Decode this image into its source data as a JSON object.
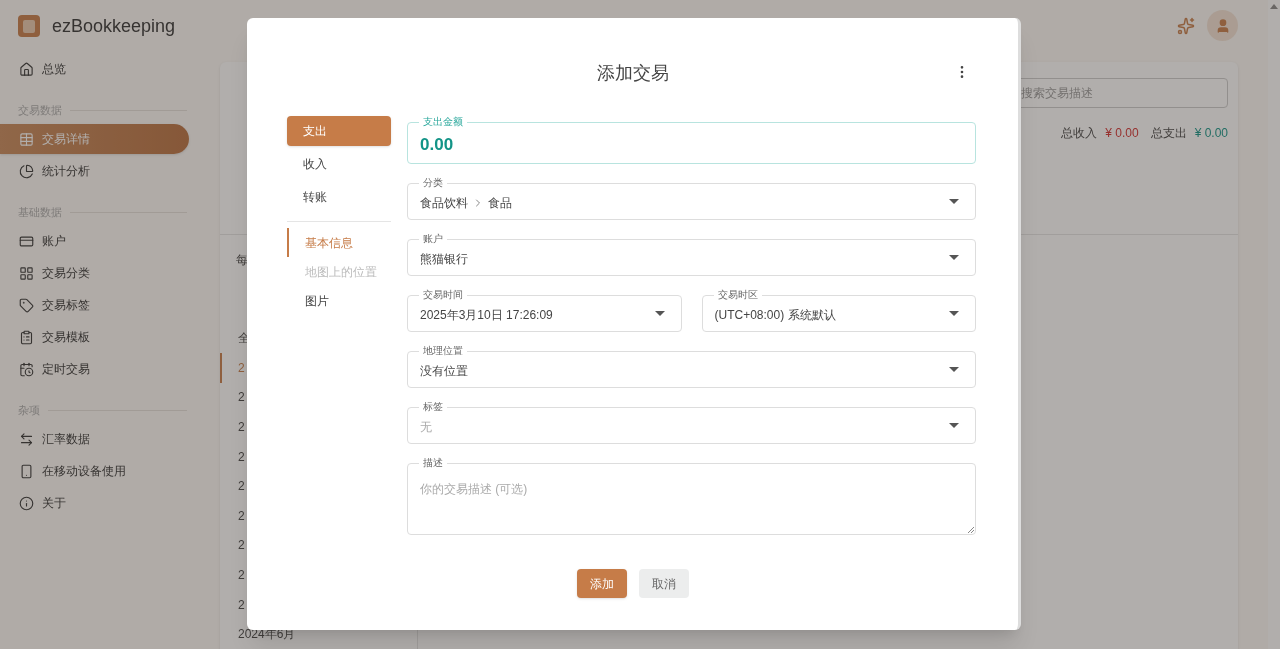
{
  "app": {
    "name": "ezBookkeeping"
  },
  "sidebar": {
    "sections": [
      {
        "items": [
          {
            "label": "总览",
            "selected": false
          }
        ]
      },
      {
        "title": "交易数据",
        "items": [
          {
            "label": "交易详情",
            "selected": true
          },
          {
            "label": "统计分析",
            "selected": false
          }
        ]
      },
      {
        "title": "基础数据",
        "items": [
          {
            "label": "账户",
            "selected": false
          },
          {
            "label": "交易分类",
            "selected": false
          },
          {
            "label": "交易标签",
            "selected": false
          },
          {
            "label": "交易模板",
            "selected": false
          },
          {
            "label": "定时交易",
            "selected": false
          }
        ]
      },
      {
        "title": "杂项",
        "items": [
          {
            "label": "汇率数据",
            "selected": false
          },
          {
            "label": "在移动设备使用",
            "selected": false
          },
          {
            "label": "关于",
            "selected": false
          }
        ]
      }
    ]
  },
  "main": {
    "search": {
      "placeholder": "搜索交易描述"
    },
    "totals": [
      {
        "kind": "income",
        "label": "总收入",
        "value": "¥ 0.00"
      },
      {
        "kind": "expense",
        "label": "总支出",
        "value": "¥ 0.00"
      }
    ],
    "filter_label": "每",
    "month_list": [
      {
        "label": "全",
        "selected": false
      },
      {
        "label": "2",
        "selected": true
      },
      {
        "label": "2",
        "selected": false
      },
      {
        "label": "2",
        "selected": false
      },
      {
        "label": "2",
        "selected": false
      },
      {
        "label": "2",
        "selected": false
      },
      {
        "label": "2",
        "selected": false
      },
      {
        "label": "2",
        "selected": false
      },
      {
        "label": "2",
        "selected": false
      },
      {
        "label": "2",
        "selected": false
      },
      {
        "label": "2024年6月",
        "selected": false
      }
    ]
  },
  "dialog": {
    "title": "添加交易",
    "types": [
      {
        "label": "支出",
        "selected": true
      },
      {
        "label": "收入",
        "selected": false
      },
      {
        "label": "转账",
        "selected": false
      }
    ],
    "sections": [
      {
        "label": "基本信息",
        "selected": true,
        "disabled": false
      },
      {
        "label": "地图上的位置",
        "selected": false,
        "disabled": true
      },
      {
        "label": "图片",
        "selected": false,
        "disabled": false
      }
    ],
    "rows": [
      [
        {
          "kind": "amount",
          "label": "支出金额",
          "value": "0.00"
        }
      ],
      [
        {
          "kind": "select",
          "label": "分类",
          "path": [
            "食品饮料",
            "食品"
          ]
        }
      ],
      [
        {
          "kind": "select",
          "label": "账户",
          "value": "熊猫银行"
        }
      ],
      [
        {
          "kind": "select",
          "label": "交易时间",
          "value": "2025年3月10日 17:26:09"
        },
        {
          "kind": "select",
          "label": "交易时区",
          "value": "(UTC+08:00) 系统默认"
        }
      ],
      [
        {
          "kind": "select",
          "label": "地理位置",
          "value": "没有位置"
        }
      ],
      [
        {
          "kind": "select",
          "label": "标签",
          "placeholder": "无"
        }
      ],
      [
        {
          "kind": "textarea",
          "label": "描述",
          "placeholder": "你的交易描述 (可选)"
        }
      ]
    ],
    "buttons": [
      {
        "kind": "primary",
        "label": "添加"
      },
      {
        "kind": "secondary",
        "label": "取消"
      }
    ]
  }
}
